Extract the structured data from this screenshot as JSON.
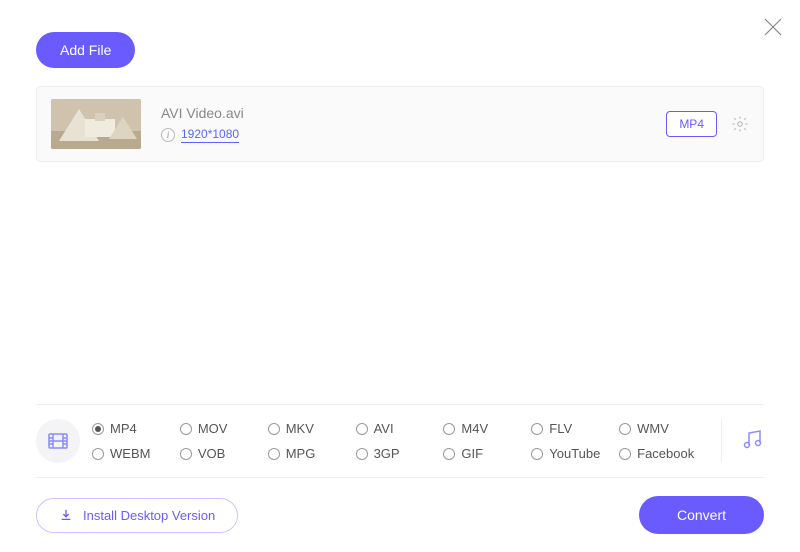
{
  "header": {
    "add_label": "Add File"
  },
  "file": {
    "name": "AVI Video.avi",
    "resolution": "1920*1080",
    "format_chip": "MP4"
  },
  "formats": {
    "selected": "MP4",
    "row1": [
      "MP4",
      "MOV",
      "MKV",
      "AVI",
      "M4V",
      "FLV",
      "WMV"
    ],
    "row2": [
      "WEBM",
      "VOB",
      "MPG",
      "3GP",
      "GIF",
      "YouTube",
      "Facebook"
    ]
  },
  "footer": {
    "install_label": "Install Desktop Version",
    "convert_label": "Convert"
  },
  "colors": {
    "accent": "#6a5bff"
  }
}
